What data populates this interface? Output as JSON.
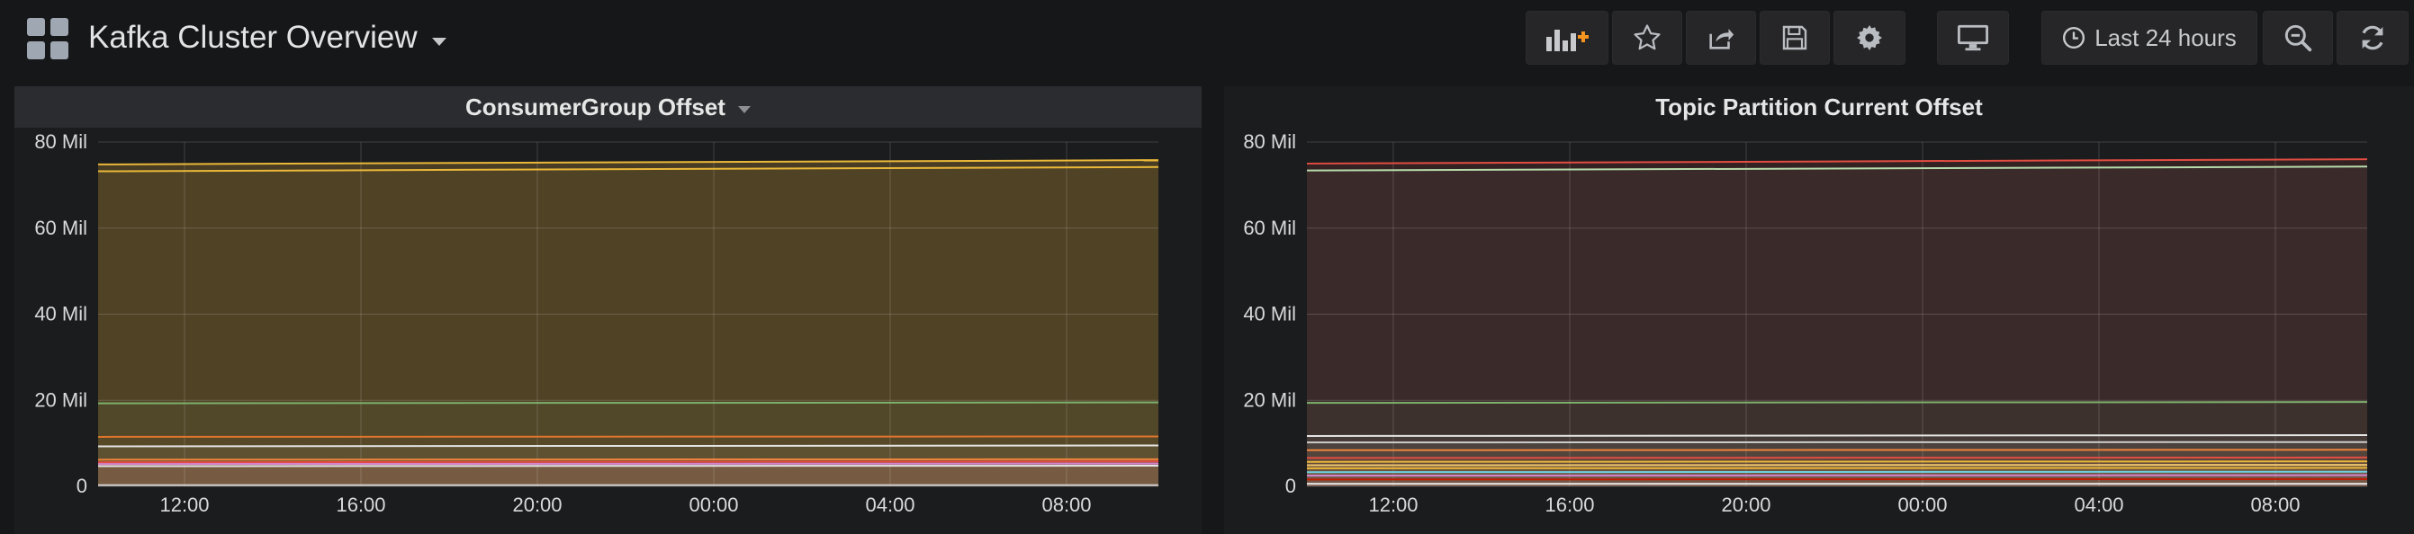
{
  "header": {
    "title": "Kafka Cluster Overview",
    "time_range": "Last 24 hours",
    "icons": [
      "add-panel-icon",
      "star-icon",
      "share-icon",
      "save-icon",
      "gear-icon",
      "monitor-icon",
      "clock-icon",
      "zoom-out-icon",
      "refresh-icon"
    ],
    "accent_color": "#f79420"
  },
  "panels": [
    {
      "title": "ConsumerGroup Offset",
      "chart_data": {
        "type": "area",
        "title": "ConsumerGroup Offset",
        "y_ticks": [
          "0",
          "20 Mil",
          "40 Mil",
          "60 Mil",
          "80 Mil"
        ],
        "x_ticks": [
          "12:00",
          "16:00",
          "20:00",
          "00:00",
          "04:00",
          "08:00"
        ],
        "ylim": [
          0,
          80
        ],
        "y_unit": "Mil",
        "grid": true,
        "series": [
          {
            "color": "#eab839",
            "values": [
              74.8,
              75.8
            ]
          },
          {
            "color": "#eab839",
            "values": [
              73.2,
              74.2
            ]
          },
          {
            "color": "#7eb26d",
            "values": [
              19.3,
              19.5
            ]
          },
          {
            "color": "#e0752d",
            "values": [
              11.5,
              11.6
            ]
          },
          {
            "color": "#e5e5e5",
            "values": [
              9.3,
              9.5
            ]
          },
          {
            "color": "#ef843c",
            "values": [
              6.2,
              6.3
            ]
          },
          {
            "color": "#e24d42",
            "values": [
              5.6,
              5.8
            ]
          },
          {
            "color": "#d683ce",
            "values": [
              5.2,
              5.3
            ]
          },
          {
            "color": "#e5e5e5",
            "values": [
              4.7,
              4.8
            ]
          },
          {
            "color": "#cccccc",
            "values": [
              0.3,
              0.3
            ]
          }
        ]
      }
    },
    {
      "title": "Topic Partition Current Offset",
      "chart_data": {
        "type": "area",
        "title": "Topic Partition Current Offset",
        "y_ticks": [
          "0",
          "20 Mil",
          "40 Mil",
          "60 Mil",
          "80 Mil"
        ],
        "x_ticks": [
          "12:00",
          "16:00",
          "20:00",
          "00:00",
          "04:00",
          "08:00"
        ],
        "ylim": [
          0,
          80
        ],
        "y_unit": "Mil",
        "grid": true,
        "series": [
          {
            "color": "#e24d42",
            "values": [
              75.0,
              76.0
            ]
          },
          {
            "color": "#b7dbab",
            "values": [
              73.4,
              74.3
            ]
          },
          {
            "color": "#7eb26d",
            "values": [
              19.4,
              19.6
            ]
          },
          {
            "color": "#e5e5e5",
            "values": [
              11.7,
              11.9
            ]
          },
          {
            "color": "#cccccc",
            "values": [
              10.2,
              10.3
            ]
          },
          {
            "color": "#ef843c",
            "values": [
              8.4,
              8.5
            ]
          },
          {
            "color": "#e24d42",
            "values": [
              6.6,
              6.7
            ]
          },
          {
            "color": "#eab839",
            "values": [
              5.7,
              5.8
            ]
          },
          {
            "color": "#f2c96d",
            "values": [
              4.9,
              5.0
            ]
          },
          {
            "color": "#eab839",
            "values": [
              4.2,
              4.3
            ]
          },
          {
            "color": "#6ed0e0",
            "values": [
              3.3,
              3.4
            ]
          },
          {
            "color": "#d683ce",
            "values": [
              2.5,
              2.6
            ]
          },
          {
            "color": "#bf1b00",
            "values": [
              1.6,
              1.7
            ]
          },
          {
            "color": "#e5e5e5",
            "values": [
              0.6,
              0.6
            ]
          }
        ]
      }
    }
  ]
}
